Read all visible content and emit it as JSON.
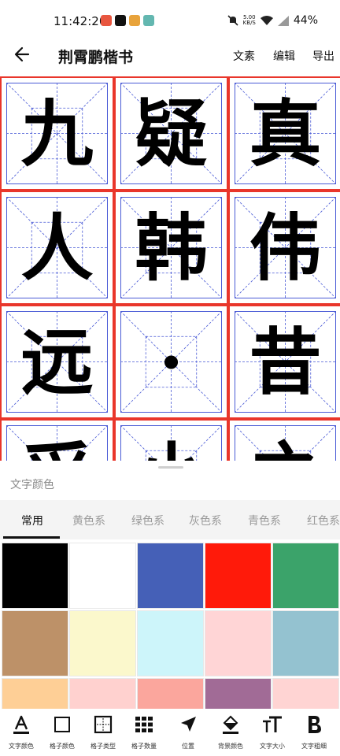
{
  "status_bar": {
    "time": "11:42:20",
    "net_speed_top": "5.00",
    "net_speed_bottom": "KB/S",
    "battery": "44%",
    "app_icon_colors": [
      "#e8563f",
      "#111111",
      "#e8a33b",
      "#63b7b0"
    ]
  },
  "app_bar": {
    "title": "荆霄鹏楷书",
    "actions": [
      "文素",
      "编辑",
      "导出"
    ],
    "back_icon": "arrow-left-icon"
  },
  "grid": {
    "grid_type": "米字格",
    "cell_border_color": "#e9362b",
    "guide_color": "#4a5bd6",
    "rows": [
      [
        "九",
        "疑",
        "真"
      ],
      [
        "人",
        "韩",
        "伟"
      ],
      [
        "远",
        "·",
        "昔"
      ],
      [
        "采",
        "小",
        "之"
      ]
    ]
  },
  "panel": {
    "title": "文字颜色",
    "tabs": [
      "常用",
      "黄色系",
      "绿色系",
      "灰色系",
      "青色系",
      "红色系"
    ],
    "active_tab": "常用",
    "swatches": [
      "#000000",
      "#ffffff",
      "#4560b7",
      "#ff1a0a",
      "#3ba36a",
      "#bd9168",
      "#fbf8cc",
      "#cdf5fa",
      "#ffd5d6",
      "#94c2d0",
      "#fecf96",
      "#ffd1cf",
      "#fba69d",
      "#a16b96",
      "#ffd4d3"
    ]
  },
  "toolbar": {
    "items": [
      {
        "label": "文字颜色",
        "icon": "text-color-icon"
      },
      {
        "label": "格子颜色",
        "icon": "grid-color-icon"
      },
      {
        "label": "格子类型",
        "icon": "grid-type-icon"
      },
      {
        "label": "格子数量",
        "icon": "grid-count-icon"
      },
      {
        "label": "位置",
        "icon": "position-icon"
      },
      {
        "label": "背景颜色",
        "icon": "background-color-icon"
      },
      {
        "label": "文字大小",
        "icon": "text-size-icon"
      },
      {
        "label": "文字粗细",
        "icon": "text-weight-icon"
      }
    ]
  }
}
